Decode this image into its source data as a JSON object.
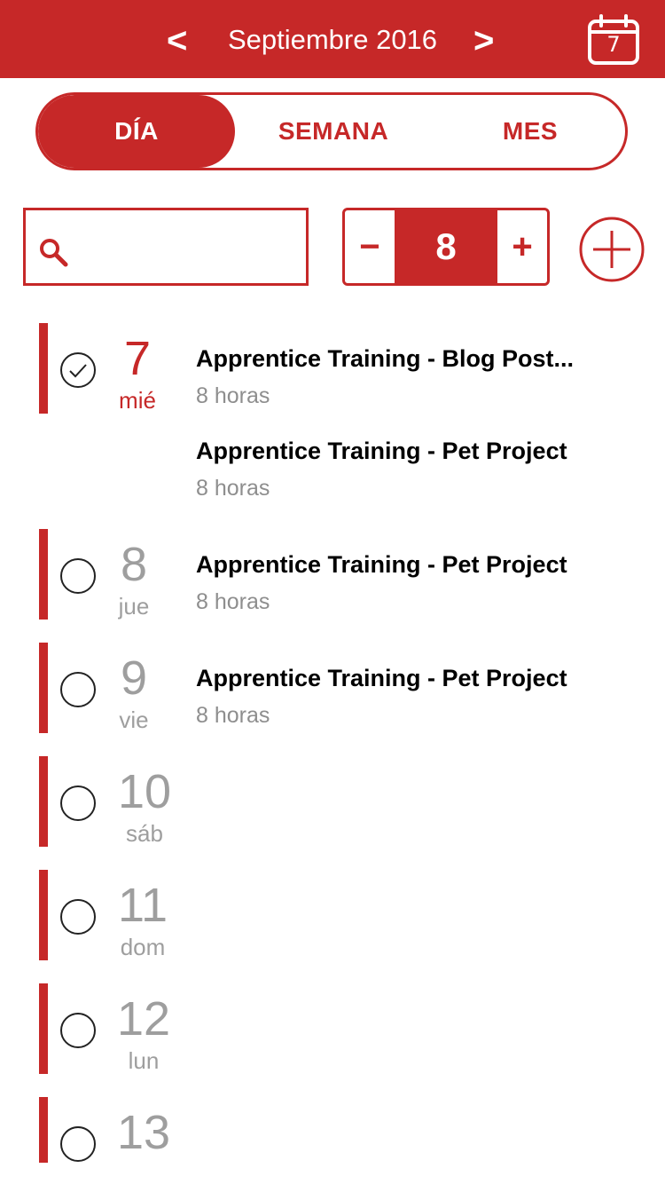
{
  "header": {
    "prev_label": "<",
    "next_label": ">",
    "month_title": "Septiembre 2016",
    "calendar_day": "7"
  },
  "tabs": [
    {
      "label": "DÍA",
      "selected": true
    },
    {
      "label": "SEMANA",
      "selected": false
    },
    {
      "label": "MES",
      "selected": false
    }
  ],
  "search": {
    "value": "",
    "placeholder": ""
  },
  "stepper": {
    "minus": "−",
    "value": "8",
    "plus": "+"
  },
  "colors": {
    "accent": "#c62828",
    "muted": "#9e9e9e"
  },
  "days": [
    {
      "num": "7",
      "name": "mié",
      "active": true,
      "checked": true,
      "tasks": [
        {
          "title": "Apprentice Training - Blog Post...",
          "hours": "8 horas"
        },
        {
          "title": "Apprentice Training - Pet Project",
          "hours": "8 horas"
        }
      ]
    },
    {
      "num": "8",
      "name": "jue",
      "active": false,
      "checked": false,
      "tasks": [
        {
          "title": "Apprentice Training - Pet Project",
          "hours": "8 horas"
        }
      ]
    },
    {
      "num": "9",
      "name": "vie",
      "active": false,
      "checked": false,
      "tasks": [
        {
          "title": "Apprentice Training - Pet Project",
          "hours": "8 horas"
        }
      ]
    },
    {
      "num": "10",
      "name": "sáb",
      "active": false,
      "checked": false,
      "tasks": []
    },
    {
      "num": "11",
      "name": "dom",
      "active": false,
      "checked": false,
      "tasks": []
    },
    {
      "num": "12",
      "name": "lun",
      "active": false,
      "checked": false,
      "tasks": []
    },
    {
      "num": "13",
      "name": "",
      "active": false,
      "checked": false,
      "tasks": []
    }
  ]
}
